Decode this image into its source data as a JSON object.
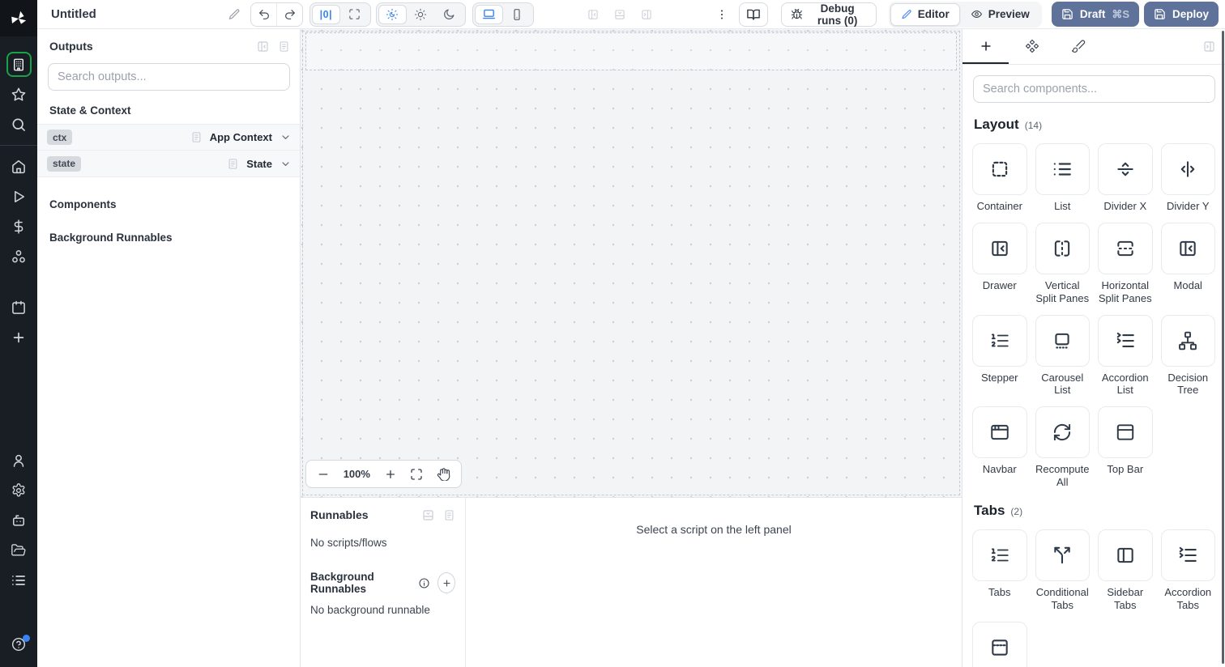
{
  "app": {
    "title": "Untitled"
  },
  "topbar": {
    "zoom_fit_label": "|0|",
    "debug_runs_label": "Debug runs (0)",
    "editor_label": "Editor",
    "preview_label": "Preview",
    "draft_label": "Draft",
    "draft_shortcut": "⌘S",
    "deploy_label": "Deploy"
  },
  "outputs": {
    "title": "Outputs",
    "search_placeholder": "Search outputs...",
    "section_state_context": "State & Context",
    "section_components": "Components",
    "section_background_runnables": "Background Runnables",
    "rows": [
      {
        "badge": "ctx",
        "label": "App Context"
      },
      {
        "badge": "state",
        "label": "State"
      }
    ]
  },
  "canvas": {
    "zoom_level": "100%"
  },
  "runnables": {
    "title": "Runnables",
    "empty": "No scripts/flows",
    "background_title": "Background Runnables",
    "background_empty": "No background runnable",
    "select_hint": "Select a script on the left panel"
  },
  "components_panel": {
    "search_placeholder": "Search components...",
    "sections": [
      {
        "title": "Layout",
        "count_label": "(14)",
        "items": [
          {
            "label": "Container",
            "icon": "container-icon"
          },
          {
            "label": "List",
            "icon": "list-icon"
          },
          {
            "label": "Divider X",
            "icon": "divider-x-icon"
          },
          {
            "label": "Divider Y",
            "icon": "divider-y-icon"
          },
          {
            "label": "Drawer",
            "icon": "drawer-icon"
          },
          {
            "label": "Vertical Split Panes",
            "icon": "vertical-split-icon"
          },
          {
            "label": "Horizontal Split Panes",
            "icon": "horizontal-split-icon"
          },
          {
            "label": "Modal",
            "icon": "modal-icon"
          },
          {
            "label": "Stepper",
            "icon": "stepper-icon"
          },
          {
            "label": "Carousel List",
            "icon": "carousel-icon"
          },
          {
            "label": "Accordion List",
            "icon": "accordion-list-icon"
          },
          {
            "label": "Decision Tree",
            "icon": "decision-tree-icon"
          },
          {
            "label": "Navbar",
            "icon": "navbar-icon"
          },
          {
            "label": "Recompute All",
            "icon": "recompute-icon"
          },
          {
            "label": "Top Bar",
            "icon": "top-bar-icon"
          }
        ]
      },
      {
        "title": "Tabs",
        "count_label": "(2)",
        "items": [
          {
            "label": "Tabs",
            "icon": "tabs-icon"
          },
          {
            "label": "Conditional Tabs",
            "icon": "conditional-tabs-icon"
          },
          {
            "label": "Sidebar Tabs",
            "icon": "sidebar-tabs-icon"
          },
          {
            "label": "Accordion Tabs",
            "icon": "accordion-tabs-icon"
          },
          {
            "label": "",
            "icon": "invisible-tabs-icon"
          }
        ]
      }
    ]
  },
  "sidebar": {
    "top": [
      {
        "icon": "apps-icon",
        "active": true
      },
      {
        "icon": "favorites-icon"
      },
      {
        "icon": "search-icon"
      },
      {
        "divider": true
      },
      {
        "icon": "home-icon"
      },
      {
        "icon": "runs-icon"
      },
      {
        "icon": "variables-icon"
      },
      {
        "icon": "resources-icon"
      },
      {
        "spacer": 26
      },
      {
        "icon": "schedules-icon"
      },
      {
        "icon": "add-icon"
      }
    ],
    "bottom": [
      {
        "icon": "user-icon"
      },
      {
        "icon": "settings-icon"
      },
      {
        "icon": "ai-assistant-icon"
      },
      {
        "icon": "workspace-folder-icon"
      },
      {
        "icon": "audit-logs-icon"
      },
      {
        "spacer": 42
      },
      {
        "icon": "help-icon",
        "badge": true
      }
    ]
  },
  "colors": {
    "accent_blue": "#3b82f6",
    "active_green": "#16a34a",
    "primary_button_bg": "#5f7299",
    "canvas_bg": "#f3f4f6"
  }
}
